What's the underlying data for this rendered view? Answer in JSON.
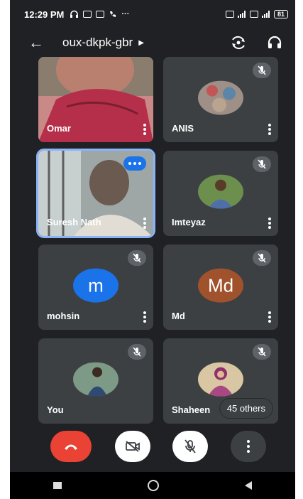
{
  "status_bar": {
    "time": "12:29 PM",
    "extra": "···",
    "battery": "81"
  },
  "header": {
    "meeting_code": "oux-dkpk-gbr"
  },
  "participants": [
    {
      "name": "Omar"
    },
    {
      "name": "ANIS"
    },
    {
      "name": "Suresh Nath"
    },
    {
      "name": "Imteyaz"
    },
    {
      "name": "mohsin",
      "initial": "m",
      "initial_color": "#1a73e8"
    },
    {
      "name": "Md",
      "initial": "Md",
      "initial_color": "#a0522d"
    },
    {
      "name": "You"
    },
    {
      "name": "Shaheen"
    }
  ],
  "others_label": "45 others",
  "colors": {
    "background": "#202124",
    "tile": "#3c4043",
    "end_call": "#ea4335",
    "active_outline": "#8ab4f8"
  },
  "icons": [
    "back-arrow-icon",
    "caret-icon",
    "switch-camera-icon",
    "headphones-icon",
    "mic-off-icon",
    "more-vert-icon",
    "end-call-icon",
    "camera-off-icon"
  ]
}
